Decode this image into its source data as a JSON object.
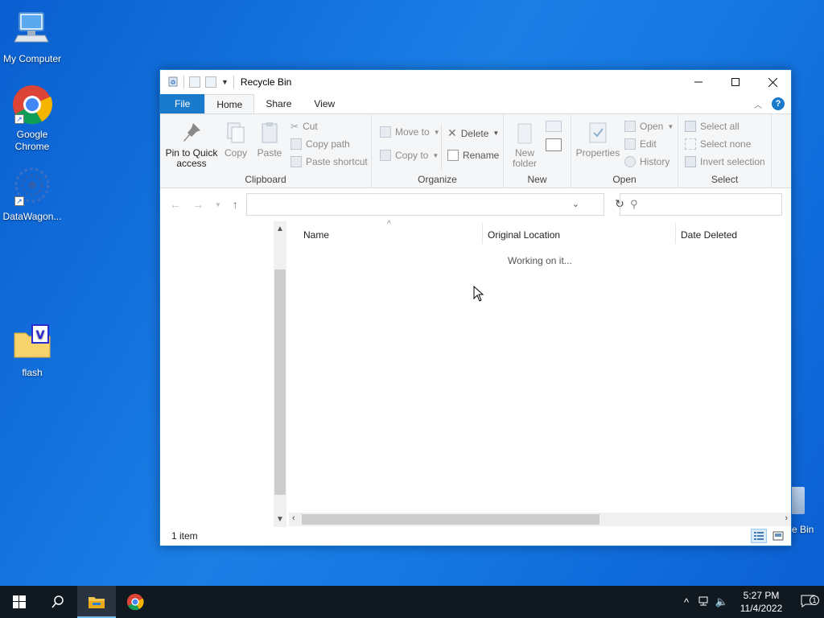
{
  "desktop": {
    "icons": [
      {
        "label": "My Computer"
      },
      {
        "label": "Google Chrome"
      },
      {
        "label": "DataWagon..."
      },
      {
        "label": "flash"
      }
    ],
    "recycle_partial_label": "e Bin"
  },
  "window": {
    "title": "Recycle Bin",
    "tabs": {
      "file": "File",
      "home": "Home",
      "share": "Share",
      "view": "View"
    },
    "ribbon": {
      "clipboard": {
        "label": "Clipboard",
        "pin": "Pin to Quick access",
        "copy": "Copy",
        "paste": "Paste",
        "cut": "Cut",
        "copy_path": "Copy path",
        "paste_shortcut": "Paste shortcut"
      },
      "organize": {
        "label": "Organize",
        "move_to": "Move to",
        "copy_to": "Copy to",
        "delete": "Delete",
        "rename": "Rename"
      },
      "new": {
        "label": "New",
        "new_folder": "New folder"
      },
      "open": {
        "label": "Open",
        "properties": "Properties",
        "open": "Open",
        "edit": "Edit",
        "history": "History"
      },
      "select": {
        "label": "Select",
        "select_all": "Select all",
        "select_none": "Select none",
        "invert": "Invert selection"
      }
    },
    "columns": {
      "name": "Name",
      "original_location": "Original Location",
      "date_deleted": "Date Deleted"
    },
    "working_text": "Working on it...",
    "status": "1 item"
  },
  "taskbar": {
    "time": "5:27 PM",
    "date": "11/4/2022",
    "notification_count": "1"
  }
}
